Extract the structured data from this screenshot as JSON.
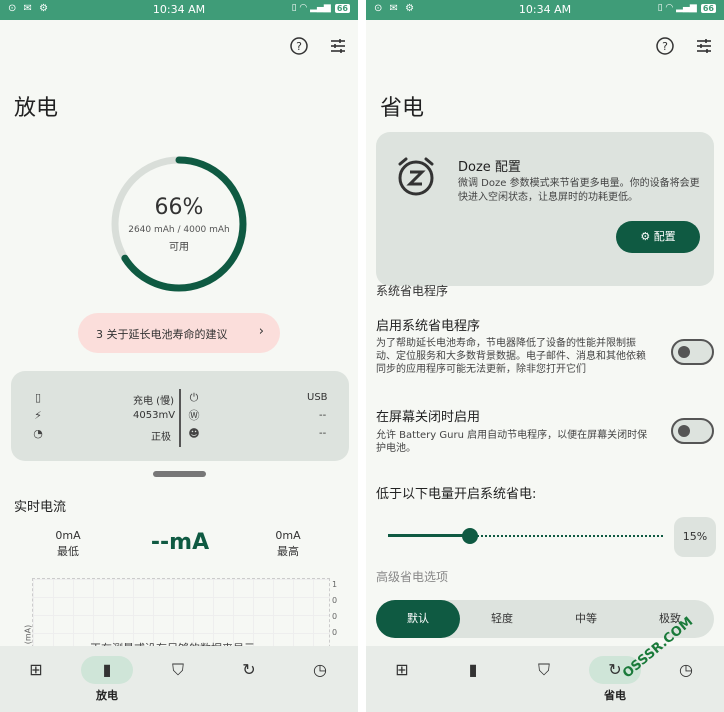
{
  "status_bar": {
    "time": "10:34 AM",
    "battery_level": "66",
    "left_icons": "⊙ ✉ ⚙",
    "right_icons": "▯ ◠ ▂▄▆"
  },
  "left_screen": {
    "title": "放电",
    "ring": {
      "percent": "66%",
      "capacity": "2640 mAh / 4000 mAh",
      "available": "可用",
      "level": 0.66
    },
    "tips_label": "3 关于延长电池寿命的建议",
    "info": {
      "state_value": "充电 (慢)",
      "voltage_value": "4053mV",
      "health_value": "正极",
      "plug_value": "USB",
      "wattage_value": "--",
      "temp_value": "--"
    },
    "realtime": {
      "section_title": "实时电流",
      "min_value": "0mA",
      "min_label": "最低",
      "current": "--mA",
      "max_value": "0mA",
      "max_label": "最高",
      "chart_ticks": [
        "1",
        "0",
        "0",
        "0"
      ],
      "chart_ylabel": "(mA)",
      "chart_message": "正在测量或没有足够的数据来显示"
    }
  },
  "right_screen": {
    "title": "省电",
    "doze": {
      "title": "Doze 配置",
      "description": "微调 Doze 参数模式来节省更多电量。你的设备将会更快进入空闲状态，让息屏时的功耗更低。",
      "button_label": "配置"
    },
    "section_system": "系统省电程序",
    "option1": {
      "title": "启用系统省电程序",
      "description": "为了帮助延长电池寿命，节电器降低了设备的性能并限制振动、定位服务和大多数背景数据。电子邮件、消息和其他依赖同步的应用程序可能无法更新，除非您打开它们",
      "enabled": false
    },
    "option2": {
      "title": "在屏幕关闭时启用",
      "description": "允许 Battery Guru 启用自动节电程序，以便在屏幕关闭时保护电池。",
      "enabled": false
    },
    "threshold_label": "低于以下电量开启系统省电:",
    "threshold_value": "15%",
    "threshold_fraction": 0.15,
    "advanced_label": "高级省电选项",
    "modes": [
      "默认",
      "轻度",
      "中等",
      "极致"
    ],
    "selected_mode": "默认"
  },
  "nav": {
    "left_active_label": "放电",
    "right_active_label": "省电",
    "icons": [
      "battery-charging-icon",
      "battery-icon",
      "shield-icon",
      "cycle-icon",
      "history-icon"
    ]
  },
  "watermark": "OSSSR.COM",
  "colors": {
    "accent": "#0f5a42",
    "statusbar": "#3f9c78",
    "tips_bg": "#fbdedb",
    "card_bg": "#dde3de"
  }
}
